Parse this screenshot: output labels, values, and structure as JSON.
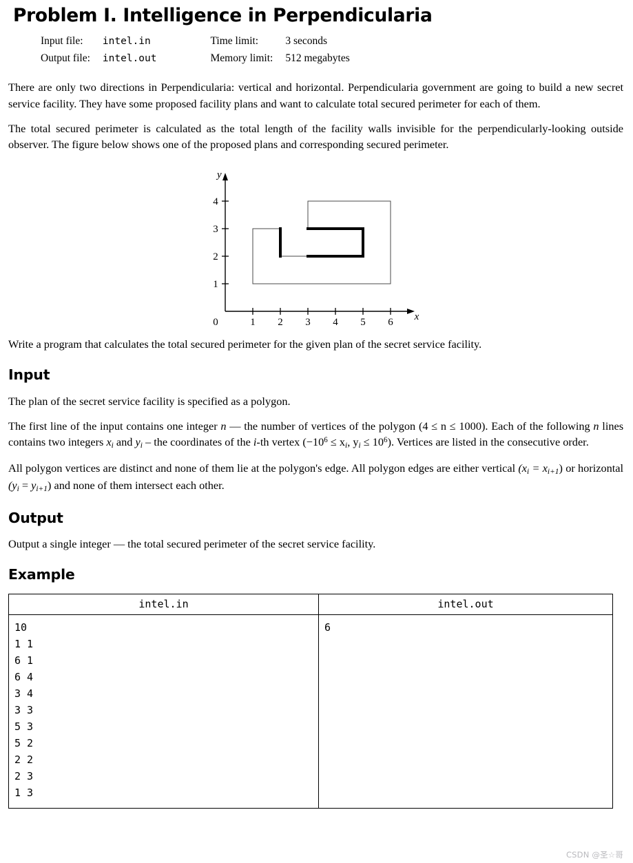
{
  "title": "Problem I. Intelligence in Perpendicularia",
  "meta": {
    "input_file_label": "Input file:",
    "input_file_value": "intel.in",
    "output_file_label": "Output file:",
    "output_file_value": "intel.out",
    "time_limit_label": "Time limit:",
    "time_limit_value": "3 seconds",
    "memory_limit_label": "Memory limit:",
    "memory_limit_value": "512 megabytes"
  },
  "paragraphs": {
    "intro1": "There are only two directions in Perpendicularia: vertical and horizontal. Perpendicularia government are going to build a new secret service facility. They have some proposed facility plans and want to calculate total secured perimeter for each of them.",
    "intro2": "The total secured perimeter is calculated as the total length of the facility walls invisible for the perpendicularly-looking outside observer. The figure below shows one of the proposed plans and corresponding secured perimeter.",
    "after_figure": "Write a program that calculates the total secured perimeter for the given plan of the secret service facility.",
    "input_intro": "The plan of the secret service facility is specified as a polygon.",
    "input_line1_a": "The first line of the input contains one integer",
    "input_line1_n": "n",
    "input_line1_b": "— the number of vertices of the polygon",
    "input_line1_range": "(4 ≤ n ≤ 1000).",
    "input_line2_a": "Each of the following",
    "input_line2_n": "n",
    "input_line2_b": "lines contains two integers",
    "input_line2_xi": "x",
    "input_line2_and": "and",
    "input_line2_yi": "y",
    "input_line2_c": "– the coordinates of the",
    "input_line2_i": "i",
    "input_line2_d": "-th vertex",
    "input_line3_range_pre": "(−10",
    "input_line3_range_mid": "≤ x",
    "input_line3_range_mid2": ", y",
    "input_line3_range_post": "≤ 10",
    "input_line3_tail": "). Vertices are listed in the consecutive order.",
    "constraints_a": "All polygon vertices are distinct and none of them lie at the polygon's edge. All polygon edges are either vertical",
    "constraints_vertical": "(x",
    "constraints_eq": "= x",
    "constraints_or": "or horizontal",
    "constraints_horizontal": "(y",
    "constraints_tail": "and none of them intersect each other.",
    "output_body": "Output a single integer — the total secured perimeter of the secret service facility."
  },
  "sections": {
    "input_heading": "Input",
    "output_heading": "Output",
    "example_heading": "Example"
  },
  "example": {
    "headers": [
      "intel.in",
      "intel.out"
    ],
    "input_text": "10\n1 1\n6 1\n6 4\n3 4\n3 3\n5 3\n5 2\n2 2\n2 3\n1 3",
    "output_text": "6"
  },
  "watermark": "CSDN @圣☆哥",
  "chart_data": {
    "type": "line",
    "title": "",
    "xlabel": "x",
    "ylabel": "y",
    "origin_label": "0",
    "xticks": [
      1,
      2,
      3,
      4,
      5,
      6
    ],
    "yticks": [
      1,
      2,
      3,
      4
    ],
    "xlim": [
      0,
      7
    ],
    "ylim": [
      0,
      5
    ],
    "grid": false,
    "polygon_vertices": [
      [
        1,
        1
      ],
      [
        6,
        1
      ],
      [
        6,
        4
      ],
      [
        3,
        4
      ],
      [
        3,
        3
      ],
      [
        5,
        3
      ],
      [
        5,
        2
      ],
      [
        2,
        2
      ],
      [
        2,
        3
      ],
      [
        1,
        3
      ]
    ],
    "secured_segments": [
      {
        "from": [
          3,
          3
        ],
        "to": [
          5,
          3
        ]
      },
      {
        "from": [
          5,
          3
        ],
        "to": [
          5,
          2
        ]
      },
      {
        "from": [
          5,
          2
        ],
        "to": [
          3,
          2
        ]
      },
      {
        "from": [
          2,
          2
        ],
        "to": [
          2,
          3
        ]
      }
    ],
    "secured_perimeter_total": 6
  }
}
